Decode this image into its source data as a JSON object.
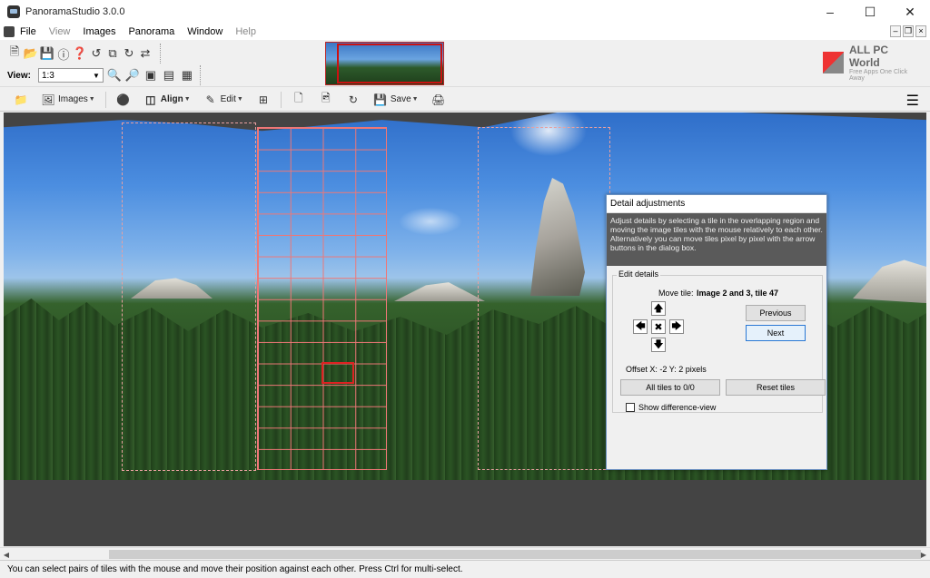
{
  "window": {
    "title": "PanoramaStudio 3.0.0"
  },
  "menu": [
    "File",
    "View",
    "Images",
    "Panorama",
    "Window",
    "Help"
  ],
  "view": {
    "label": "View:",
    "zoom": "1:3"
  },
  "brand": {
    "name": "ALL PC World",
    "tagline": "Free Apps One Click Away"
  },
  "main_toolbar": {
    "images": "Images",
    "align": "Align",
    "edit": "Edit",
    "save": "Save"
  },
  "dialog": {
    "title": "Detail adjustments",
    "description": "Adjust details by selecting a tile in the overlapping region and moving the image tiles with the mouse relatively to each other. Alternatively you can move tiles pixel by pixel with the arrow buttons in the dialog box.",
    "group_label": "Edit details",
    "move_tile_label": "Move tile:",
    "move_tile_value": "Image 2 and 3, tile 47",
    "previous": "Previous",
    "next": "Next",
    "offset": "Offset X: -2  Y: 2 pixels",
    "all_tiles": "All tiles to 0/0",
    "reset_tiles": "Reset tiles",
    "show_diff": "Show difference-view"
  },
  "status": "You can select pairs of tiles with the mouse and move their position against each other. Press Ctrl for multi-select."
}
